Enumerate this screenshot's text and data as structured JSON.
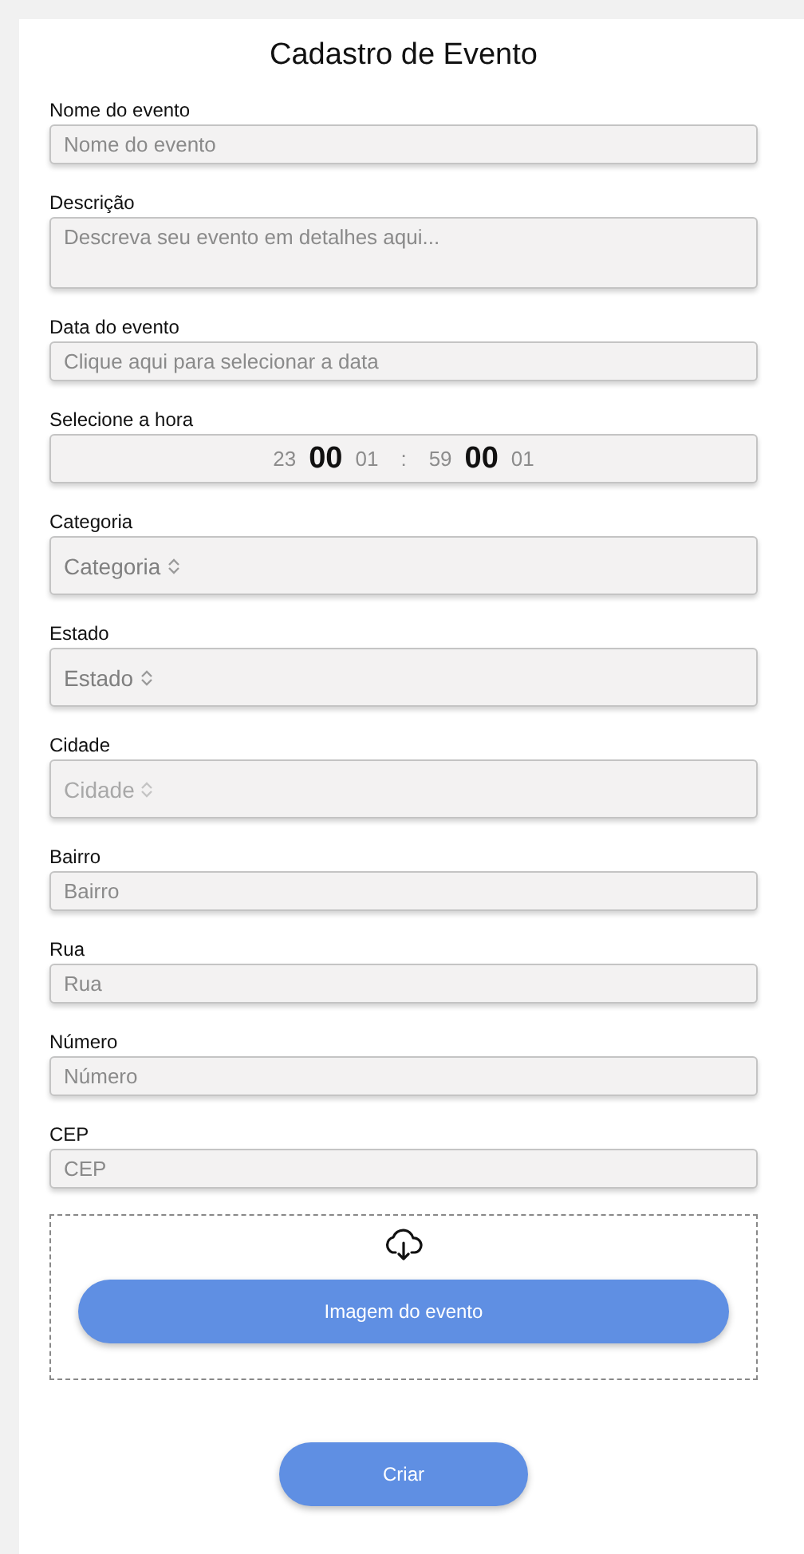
{
  "title": "Cadastro de Evento",
  "fields": [
    {
      "kind": "text",
      "label": "Nome do evento",
      "placeholder": "Nome do evento"
    },
    {
      "kind": "textarea",
      "label": "Descrição",
      "placeholder": "Descreva seu evento em detalhes aqui..."
    },
    {
      "kind": "text",
      "label": "Data do evento",
      "placeholder": "Clique aqui para selecionar a data"
    },
    {
      "kind": "time",
      "label": "Selecione a hora",
      "wheels": [
        [
          {
            "text": "23",
            "selected": false
          },
          {
            "text": "00",
            "selected": true
          },
          {
            "text": "01",
            "selected": false
          }
        ],
        [
          {
            "text": "59",
            "selected": false
          },
          {
            "text": "00",
            "selected": true
          },
          {
            "text": "01",
            "selected": false
          }
        ]
      ],
      "separator": ":"
    },
    {
      "kind": "select",
      "label": "Categoria",
      "placeholder": "Categoria",
      "disabled": false
    },
    {
      "kind": "select",
      "label": "Estado",
      "placeholder": "Estado",
      "disabled": false
    },
    {
      "kind": "select",
      "label": "Cidade",
      "placeholder": "Cidade",
      "disabled": true
    },
    {
      "kind": "text",
      "label": "Bairro",
      "placeholder": "Bairro"
    },
    {
      "kind": "text",
      "label": "Rua",
      "placeholder": "Rua"
    },
    {
      "kind": "text",
      "label": "Número",
      "placeholder": "Número"
    },
    {
      "kind": "text",
      "label": "CEP",
      "placeholder": "CEP"
    }
  ],
  "upload": {
    "button": "Imagem do evento"
  },
  "submit": "Criar"
}
